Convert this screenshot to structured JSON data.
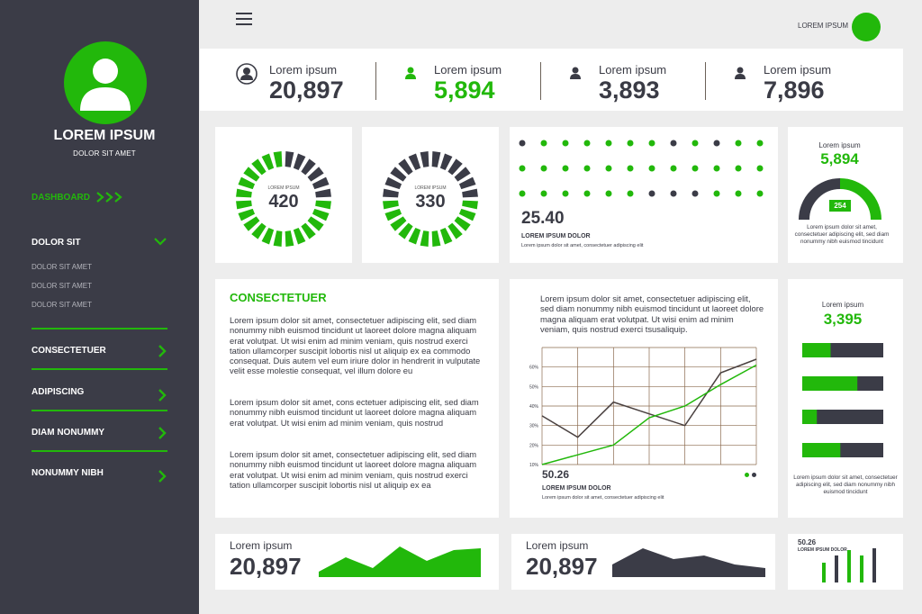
{
  "colors": {
    "accent": "#22b80b",
    "dark": "#3b3c47",
    "grid": "#8a6a4e"
  },
  "sidebar": {
    "profile_name": "LOREM IPSUM",
    "profile_subtitle": "DOLOR SIT AMET",
    "dashboard_label": "DASHBOARD",
    "section_label": "DOLOR SIT",
    "sub_items": [
      "DOLOR SIT AMET",
      "DOLOR SIT AMET",
      "DOLOR SIT AMET"
    ],
    "items": [
      "CONSECTETUER",
      "ADIPISCING",
      "DIAM NONUMMY",
      "NONUMMY NIBH"
    ]
  },
  "header": {
    "user_name": "LOREM IPSUM",
    "menu_icon": "hamburger-icon"
  },
  "stats": [
    {
      "label": "Lorem ipsum",
      "value": "20,897",
      "icon": "user-circle-icon"
    },
    {
      "label": "Lorem ipsum",
      "value": "5,894",
      "icon": "user-icon"
    },
    {
      "label": "Lorem ipsum",
      "value": "3,893",
      "icon": "user-icon"
    },
    {
      "label": "Lorem ipsum",
      "value": "7,896",
      "icon": "user-icon"
    }
  ],
  "rings": [
    {
      "label": "LOREM IPSUM",
      "value": "420"
    },
    {
      "label": "LOREM IPSUM",
      "value": "330"
    }
  ],
  "dots_card": {
    "value": "25.40",
    "title": "LOREM IPSUM DOLOR",
    "subtitle": "Lorem ipsum dolor sit amet, consectetuer adipiscing elit"
  },
  "gauge_card": {
    "label": "Lorem ipsum",
    "value": "5,894",
    "badge": "254",
    "text": "Lorem ipsum dolor sit amet, consectetuer adipiscing elit, sed diam nonummy nibh euismod tincidunt"
  },
  "text_card": {
    "title": "CONSECTETUER",
    "paragraphs": [
      "Lorem ipsum dolor sit amet, consectetuer adipiscing elit, sed diam nonummy nibh euismod tincidunt ut laoreet dolore magna aliquam erat volutpat. Ut wisi enim ad minim veniam, quis nostrud exerci tation ullamcorper suscipit lobortis nisl ut aliquip ex ea commodo consequat. Duis autem vel eum iriure dolor in hendrerit in vulputate velit esse molestie consequat, vel illum dolore eu",
      "Lorem ipsum dolor sit amet, cons ectetuer adipiscing elit, sed diam nonummy nibh euismod tincidunt ut laoreet dolore magna aliquam erat volutpat. Ut wisi enim ad minim veniam, quis nostrud",
      "Lorem ipsum dolor sit amet, consectetuer adipiscing elit, sed diam nonummy nibh euismod tincidunt ut laoreet dolore magna aliquam erat volutpat. Ut wisi enim ad minim veniam, quis nostrud exerci tation ullamcorper suscipit lobortis nisl ut aliquip ex ea"
    ]
  },
  "line_card": {
    "intro": "Lorem ipsum dolor sit amet, consectetuer adipiscing elit, sed diam nonummy nibh euismod tincidunt ut laoreet dolore magna aliquam erat volutpat. Ut wisi enim ad minim veniam, quis nostrud exerci tsusaliquip.",
    "value": "50.26",
    "title": "LOREM IPSUM DOLOR",
    "subtitle": "Lorem ipsum dolor sit amet, consectetuer adipiscing elit"
  },
  "bars_card": {
    "label": "Lorem ipsum",
    "value": "3,395",
    "text": "Lorem ipsum dolor sit amet, consectetuer adipiscing elit, sed diam nonummy nibh euismod tincidunt"
  },
  "bottom_cards": [
    {
      "label": "Lorem ipsum",
      "value": "20,897"
    },
    {
      "label": "Lorem ipsum",
      "value": "20,897"
    }
  ],
  "mini_bars_card": {
    "value": "50.26",
    "title": "LOREM IPSUM DOLOR"
  },
  "chart_data": [
    {
      "type": "scatter",
      "title": "",
      "rows": 3,
      "columns": 12,
      "points": [
        {
          "row": 0,
          "series": [
            "dark",
            "green",
            "green",
            "green",
            "green",
            "green",
            "green",
            "dark",
            "green",
            "dark",
            "green",
            "green"
          ]
        },
        {
          "row": 1,
          "series": [
            "green",
            "green",
            "green",
            "green",
            "green",
            "green",
            "green",
            "green",
            "green",
            "green",
            "green",
            "green"
          ]
        },
        {
          "row": 2,
          "series": [
            "green",
            "green",
            "green",
            "green",
            "green",
            "green",
            "dark",
            "dark",
            "dark",
            "green",
            "green",
            "green"
          ]
        }
      ]
    },
    {
      "type": "line",
      "yticks": [
        "10%",
        "20%",
        "30%",
        "40%",
        "50%",
        "60%"
      ],
      "ylim": [
        10,
        70
      ],
      "x": [
        0,
        1,
        2,
        3,
        4,
        5,
        6
      ],
      "series": [
        {
          "color": "dark",
          "values": [
            35,
            24,
            42,
            36,
            30,
            57,
            64
          ]
        },
        {
          "color": "green",
          "values": [
            10,
            15,
            20,
            34,
            40,
            51,
            61
          ]
        }
      ]
    },
    {
      "type": "bar",
      "orientation": "horizontal",
      "values": [
        35,
        68,
        18,
        47
      ],
      "xlim": [
        0,
        100
      ]
    },
    {
      "type": "area",
      "values": [
        0.15,
        0.55,
        0.25,
        0.85,
        0.45,
        0.75,
        0.8
      ]
    },
    {
      "type": "area",
      "values": [
        0.35,
        0.8,
        0.5,
        0.6,
        0.35,
        0.25
      ]
    },
    {
      "type": "bar",
      "values": [
        0.55,
        0.75,
        0.9,
        0.75,
        0.95
      ],
      "colors": [
        "green",
        "dark",
        "green",
        "green",
        "dark"
      ]
    }
  ]
}
